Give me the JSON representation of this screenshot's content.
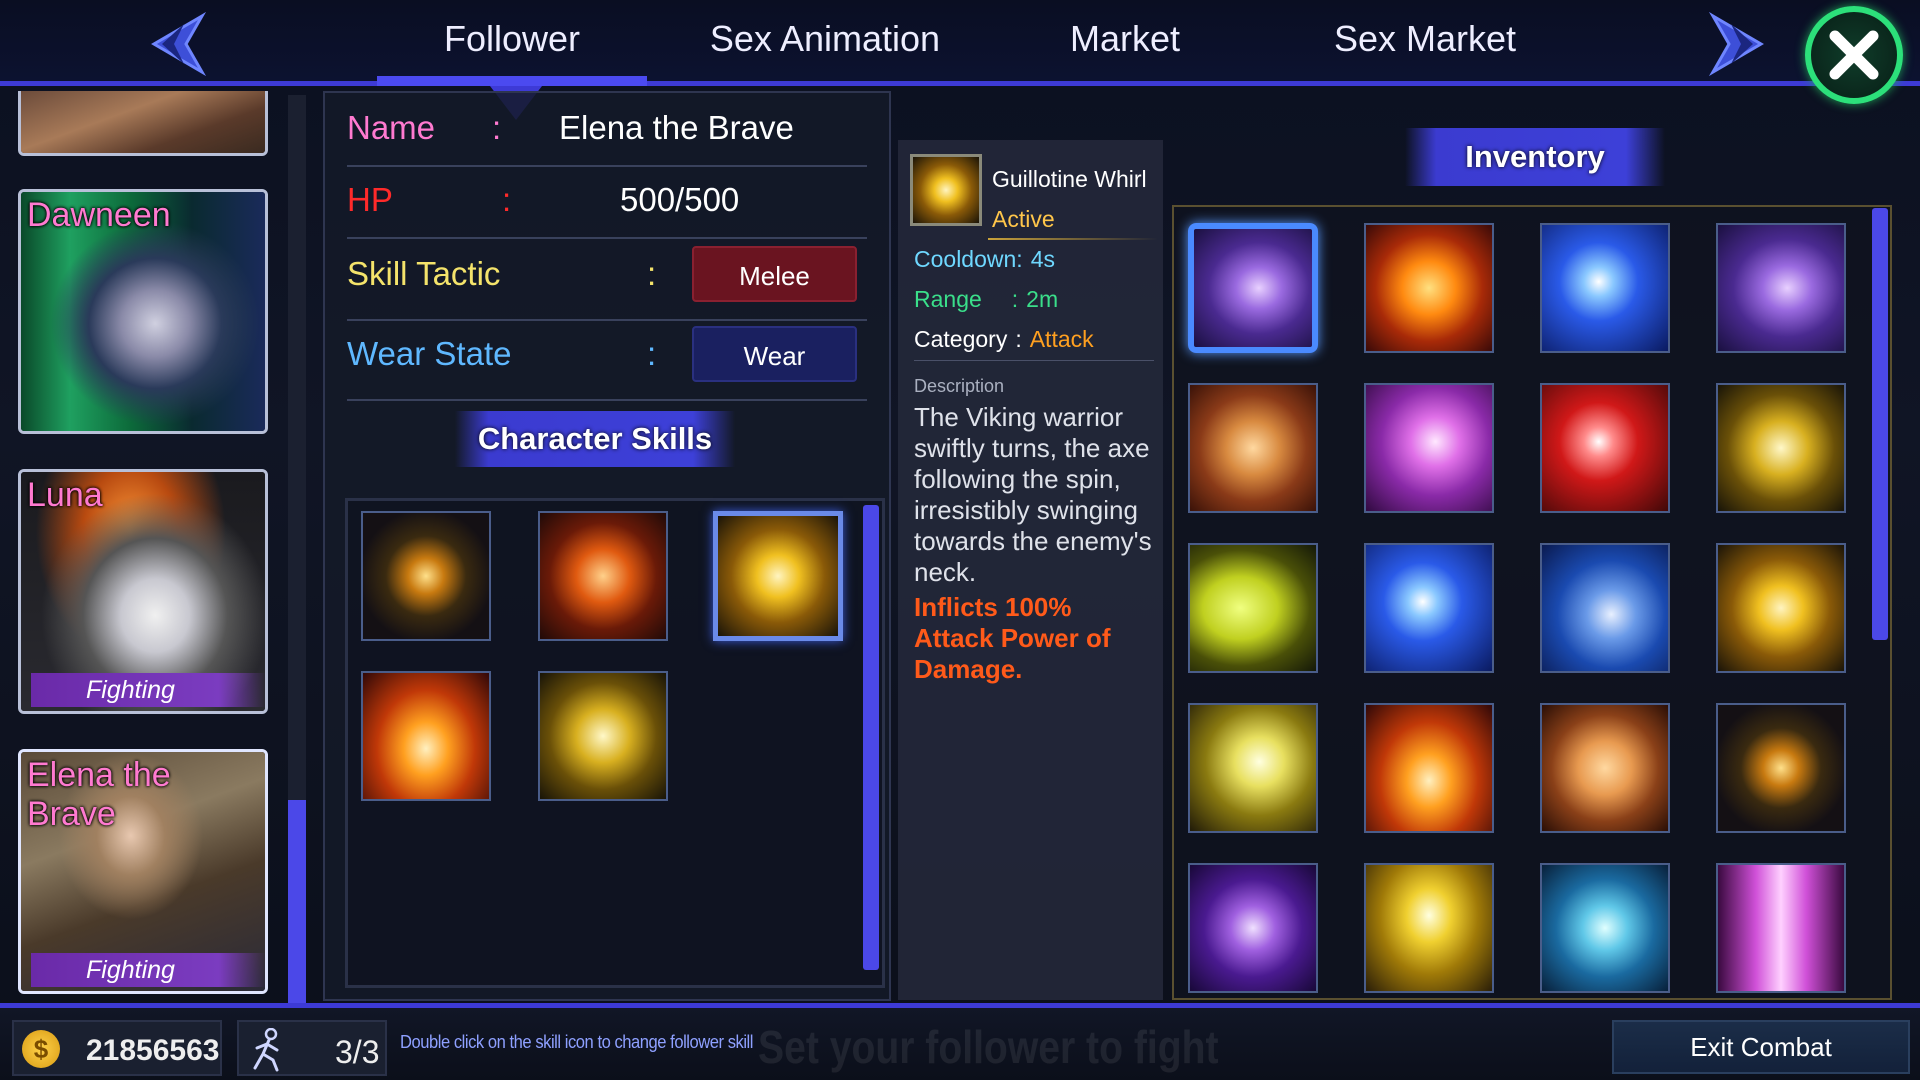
{
  "nav": {
    "tabs": [
      "Follower",
      "Sex Animation",
      "Market",
      "Sex Market"
    ],
    "active_tab": "Follower"
  },
  "followers": [
    {
      "name": "",
      "state": ""
    },
    {
      "name": "Dawneen",
      "state": ""
    },
    {
      "name": "Luna",
      "state": "Fighting"
    },
    {
      "name": "Elena the Brave",
      "state": "Fighting"
    }
  ],
  "details": {
    "name_label": "Name",
    "name_value": "Elena the Brave",
    "hp_label": "HP",
    "hp_value": "500/500",
    "tactic_label": "Skill Tactic",
    "tactic_value": "Melee",
    "wear_label": "Wear State",
    "wear_value": "Wear",
    "colon": ":"
  },
  "character_skills": {
    "title": "Character Skills",
    "skills": [
      "scythe-slash",
      "fire-axe",
      "golden-whirl",
      "fire-pillar",
      "golden-kick"
    ],
    "selected_index": 2
  },
  "skill_detail": {
    "name": "Guillotine Whirl",
    "status": "Active",
    "cooldown_label": "Cooldown",
    "cooldown_value": "4s",
    "range_label": "Range",
    "range_value": "2m",
    "category_label": "Category",
    "category_value": "Attack",
    "description_label": "Description",
    "description": "The Viking warrior swiftly turns, the axe following the spin, irresistibly swinging towards the enemy's neck.",
    "effect": "Inflicts 100% Attack Power of Damage."
  },
  "inventory": {
    "title": "Inventory",
    "items": [
      "purple-slash",
      "fire-slash",
      "blue-kick",
      "purple-slash",
      "fist-strike",
      "pink-strike",
      "red-kick",
      "golden-kick",
      "crescent-moon",
      "blue-kick",
      "blue-heel",
      "golden-whirl",
      "flying-kick",
      "fire-pillar",
      "fist",
      "scythe-slash",
      "purple-kick",
      "golden-burst",
      "ice-kick",
      "pink-leg"
    ],
    "selected_index": 0
  },
  "bottom": {
    "gold": "21856563",
    "coin_symbol": "$",
    "follower_count": "3/3",
    "hint": "Double click on the skill icon to change follower skill",
    "watermark": "Set your follower to fight",
    "exit_label": "Exit Combat"
  },
  "colors": {
    "accent": "#3d3ad6",
    "name_pink": "#ff7ad0",
    "hp_red": "#ff2a2a",
    "tactic_yellow": "#f4e36b",
    "wear_blue": "#5fb8ff",
    "active_gold": "#ffc64a",
    "effect_orange": "#ff5a1a",
    "close_green": "#2ce07a"
  }
}
